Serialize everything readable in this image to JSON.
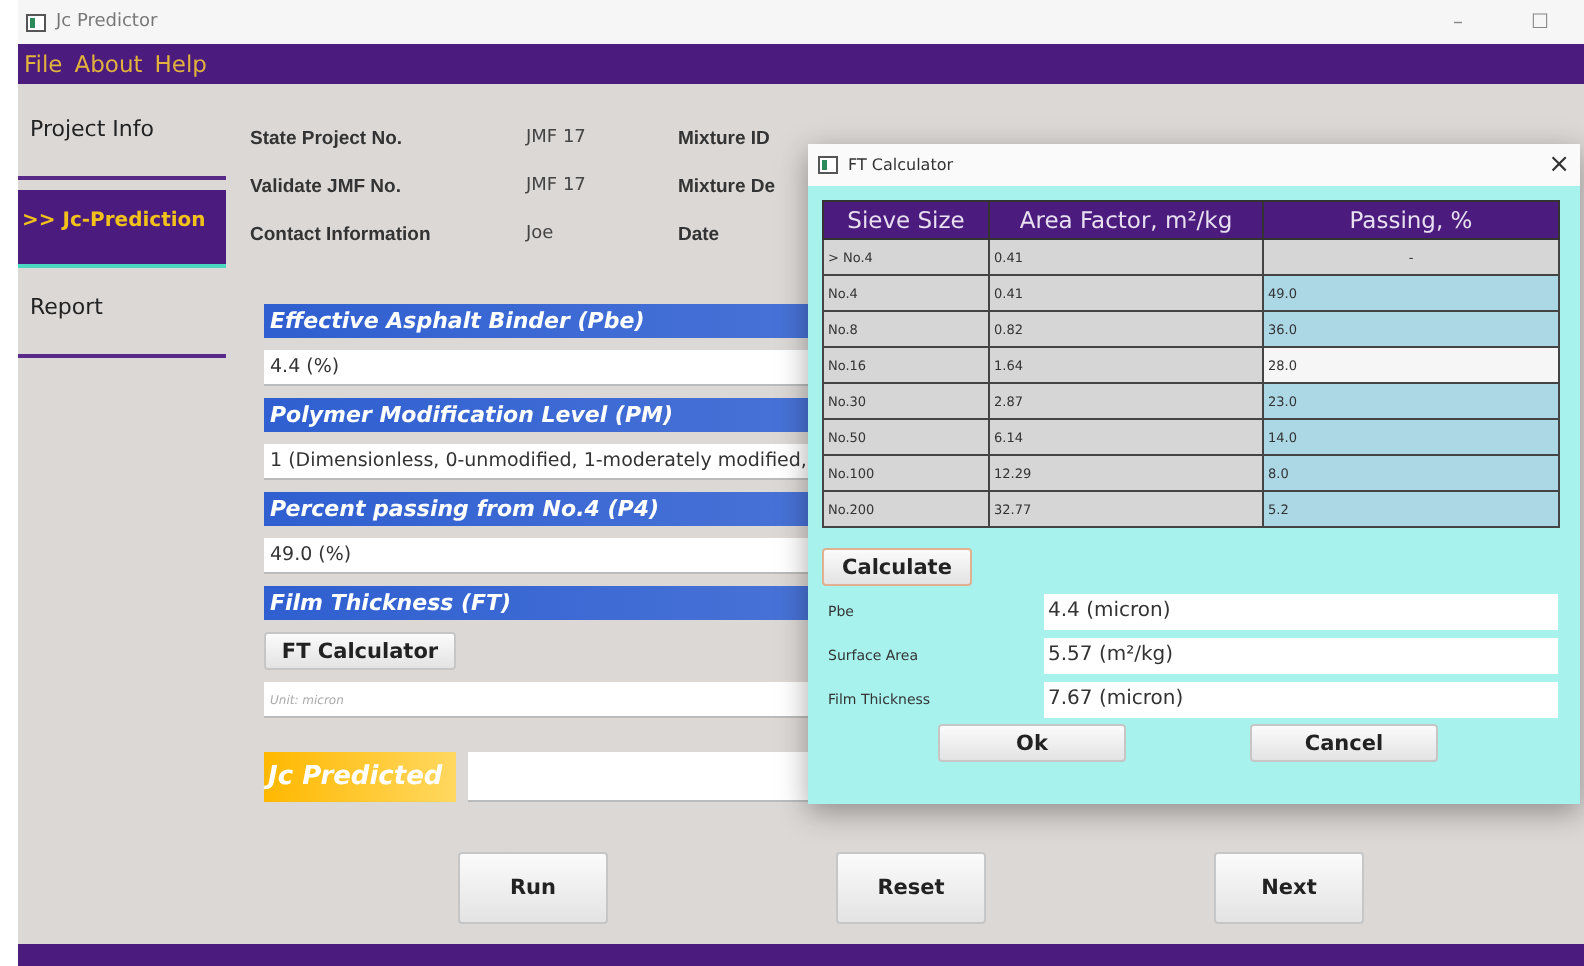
{
  "window": {
    "title": "Jc Predictor",
    "controls": [
      "–",
      "☐"
    ]
  },
  "menu": [
    "File",
    "About",
    "Help"
  ],
  "sidebar": [
    {
      "label": "Project Info",
      "selected": false
    },
    {
      "label": ">> Jc-Prediction",
      "selected": true
    },
    {
      "label": "Report",
      "selected": false
    }
  ],
  "project_info": [
    {
      "label": "State Project No.",
      "value": "JMF 17",
      "label_2": "Mixture ID"
    },
    {
      "label": "Validate JMF No.",
      "value": "JMF 17",
      "label_2": "Mixture De"
    },
    {
      "label": "Contact Information",
      "value": "Joe",
      "label_2": "Date"
    }
  ],
  "sections": [
    {
      "title": "Effective Asphalt Binder (Pbe)",
      "kind": "value",
      "value": "4.4 (%)"
    },
    {
      "title": "Polymer Modification Level (PM)",
      "kind": "value",
      "value": "1 (Dimensionless, 0-unmodified, 1-moderately modified,"
    },
    {
      "title": "Percent passing from No.4 (P4)",
      "kind": "value",
      "value": "49.0 (%)"
    },
    {
      "title": "Film Thickness (FT)",
      "kind": "calculator",
      "button": "FT Calculator",
      "placeholder": "Unit: micron"
    }
  ],
  "result": {
    "label": "Jc Predicted"
  },
  "buttons": [
    "Run",
    "Reset",
    "Next"
  ],
  "dialog": {
    "title": "FT Calculator",
    "close": "×",
    "columns": [
      "Sieve Size",
      "Area Factor, m²/kg",
      "Passing, %"
    ],
    "rows": [
      {
        "sieve": "> No.4",
        "factor": "0.41",
        "passing": "-",
        "editable": false,
        "active": false
      },
      {
        "sieve": "No.4",
        "factor": "0.41",
        "passing": "49.0",
        "editable": true,
        "active": false
      },
      {
        "sieve": "No.8",
        "factor": "0.82",
        "passing": "36.0",
        "editable": true,
        "active": false
      },
      {
        "sieve": "No.16",
        "factor": "1.64",
        "passing": "28.0",
        "editable": true,
        "active": true
      },
      {
        "sieve": "No.30",
        "factor": "2.87",
        "passing": "23.0",
        "editable": true,
        "active": false
      },
      {
        "sieve": "No.50",
        "factor": "6.14",
        "passing": "14.0",
        "editable": true,
        "active": false
      },
      {
        "sieve": "No.100",
        "factor": "12.29",
        "passing": "8.0",
        "editable": true,
        "active": false
      },
      {
        "sieve": "No.200",
        "factor": "32.77",
        "passing": "5.2",
        "editable": true,
        "active": false
      }
    ],
    "calculate": "Calculate",
    "fields": [
      {
        "label": "Pbe",
        "value": "4.4 (micron)"
      },
      {
        "label": "Surface Area",
        "value": "5.57 (m²/kg)"
      },
      {
        "label": "Film Thickness",
        "value": "7.67 (micron)"
      }
    ],
    "buttons": [
      "Ok",
      "Cancel"
    ]
  }
}
